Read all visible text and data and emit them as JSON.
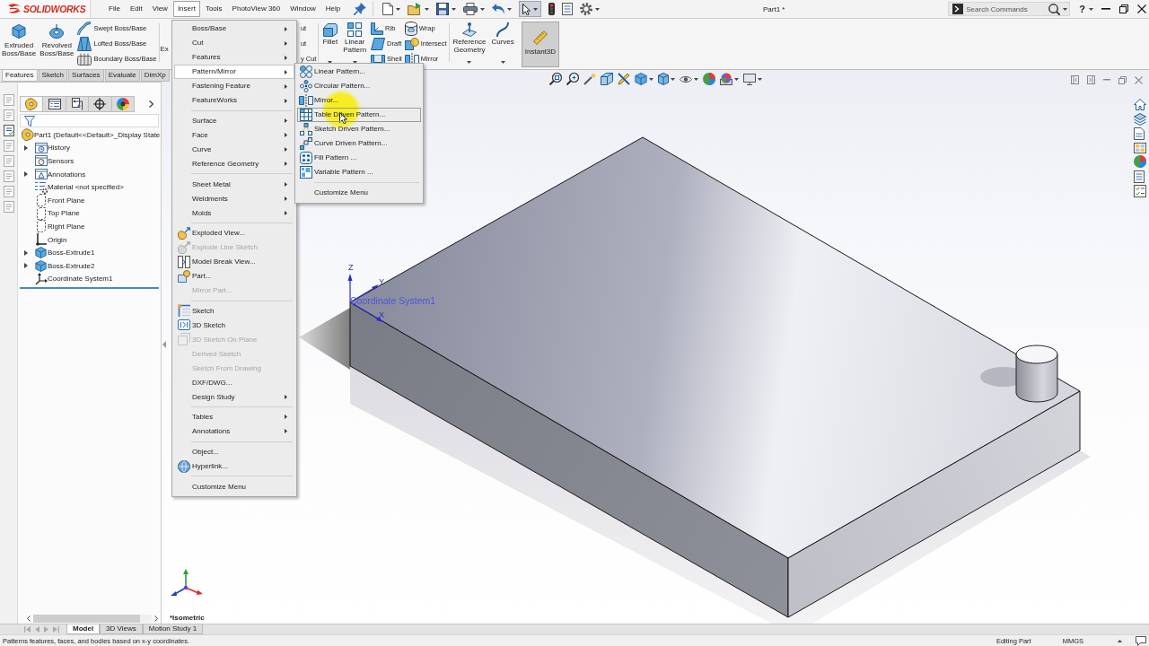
{
  "title_bar": {
    "logo": "SOLIDWORKS",
    "menus": [
      {
        "label": "File",
        "selected": false
      },
      {
        "label": "Edit",
        "selected": false
      },
      {
        "label": "View",
        "selected": false
      },
      {
        "label": "Insert",
        "selected": true
      },
      {
        "label": "Tools",
        "selected": false
      },
      {
        "label": "PhotoView 360",
        "selected": false
      },
      {
        "label": "Window",
        "selected": false
      },
      {
        "label": "Help",
        "selected": false
      }
    ],
    "document_title": "Part1 *",
    "search": {
      "placeholder": "Search Commands"
    },
    "help": "?"
  },
  "command_manager": {
    "groups": [
      [
        {
          "kind": "large",
          "label": "Extruded Boss/Base"
        },
        {
          "kind": "large",
          "label": "Revolved Boss/Base"
        },
        {
          "kind": "stack",
          "items": [
            "Swept Boss/Base",
            "Lofted Boss/Base",
            "Boundary Boss/Base"
          ]
        }
      ],
      [
        {
          "kind": "clipped",
          "label": "Ex"
        },
        {
          "kind": "clippedstack",
          "items": [
            "ut",
            "ut",
            "y Cut"
          ]
        }
      ],
      [
        {
          "kind": "split",
          "label": "Fillet"
        },
        {
          "kind": "split",
          "label": "Linear Pattern"
        },
        {
          "kind": "stack",
          "items": [
            "Rib",
            "Draft",
            "Shell"
          ]
        },
        {
          "kind": "stack",
          "items": [
            "Wrap",
            "Intersect",
            "Mirror"
          ]
        }
      ],
      [
        {
          "kind": "split",
          "label": "Reference Geometry"
        },
        {
          "kind": "split",
          "label": "Curves"
        },
        {
          "kind": "large",
          "label": "Instant3D",
          "on": true
        }
      ]
    ],
    "tabs": [
      {
        "label": "Features",
        "selected": true
      },
      {
        "label": "Sketch",
        "selected": false
      },
      {
        "label": "Surfaces",
        "selected": false
      },
      {
        "label": "Evaluate",
        "selected": false
      },
      {
        "label": "DimXp",
        "selected": false
      }
    ]
  },
  "side_toolbar": [
    {
      "disabled": true
    },
    {
      "disabled": true
    },
    {
      "disabled": false
    },
    {
      "disabled": true
    },
    {
      "disabled": true
    },
    {
      "disabled": true
    },
    {
      "disabled": true
    },
    {
      "disabled": true
    }
  ],
  "feature_manager": {
    "tabs": [
      {
        "selected": true
      },
      {
        "selected": false
      },
      {
        "selected": false
      },
      {
        "selected": false
      },
      {
        "selected": false
      }
    ],
    "tree": {
      "label": "Part1 (Default<<Default>_Display State",
      "kind": "part",
      "children": [
        {
          "label": "History",
          "kind": "history",
          "expandable": true
        },
        {
          "label": "Sensors",
          "kind": "sensors",
          "expandable": false
        },
        {
          "label": "Annotations",
          "kind": "annotations",
          "expandable": true
        },
        {
          "label": "Material <not specified>",
          "kind": "material",
          "expandable": false
        },
        {
          "label": "Front Plane",
          "kind": "plane",
          "expandable": false
        },
        {
          "label": "Top Plane",
          "kind": "plane",
          "expandable": false
        },
        {
          "label": "Right Plane",
          "kind": "plane",
          "expandable": false
        },
        {
          "label": "Origin",
          "kind": "origin",
          "expandable": false
        },
        {
          "label": "Boss-Extrude1",
          "kind": "feature",
          "expandable": true
        },
        {
          "label": "Boss-Extrude2",
          "kind": "feature",
          "expandable": true
        },
        {
          "label": "Coordinate System1",
          "kind": "coordinates",
          "expandable": false
        }
      ]
    }
  },
  "insert_menu": {
    "groups": [
      [
        {
          "label": "Boss/Base",
          "kind": "submenu",
          "selected": false,
          "disabled": false
        },
        {
          "label": "Cut",
          "kind": "submenu",
          "selected": false,
          "disabled": false
        },
        {
          "label": "Features",
          "kind": "submenu",
          "selected": false,
          "disabled": false
        },
        {
          "label": "Pattern/Mirror",
          "kind": "submenu",
          "selected": true,
          "disabled": false
        },
        {
          "label": "Fastening Feature",
          "kind": "submenu",
          "selected": false,
          "disabled": false
        },
        {
          "label": "FeatureWorks",
          "kind": "submenu",
          "selected": false,
          "disabled": false
        }
      ],
      [
        {
          "label": "Surface",
          "kind": "submenu",
          "selected": false,
          "disabled": false
        },
        {
          "label": "Face",
          "kind": "submenu",
          "selected": false,
          "disabled": false
        },
        {
          "label": "Curve",
          "kind": "submenu",
          "selected": false,
          "disabled": false
        },
        {
          "label": "Reference Geometry",
          "kind": "submenu",
          "selected": false,
          "disabled": false
        }
      ],
      [
        {
          "label": "Sheet Metal",
          "kind": "submenu",
          "selected": false,
          "disabled": false
        },
        {
          "label": "Weldments",
          "kind": "submenu",
          "selected": false,
          "disabled": false
        },
        {
          "label": "Molds",
          "kind": "submenu",
          "selected": false,
          "disabled": false
        }
      ],
      [
        {
          "label": "Exploded View...",
          "kind": "exploded",
          "selected": false,
          "disabled": false
        },
        {
          "label": "Explode Line Sketch",
          "kind": "explodeline",
          "selected": false,
          "disabled": true
        },
        {
          "label": "Model Break View...",
          "kind": "breakview",
          "selected": false,
          "disabled": false
        },
        {
          "label": "Part...",
          "kind": "part",
          "selected": false,
          "disabled": false
        },
        {
          "label": "Mirror Part...",
          "kind": "command",
          "selected": false,
          "disabled": true
        }
      ],
      [
        {
          "label": "Sketch",
          "kind": "sketch",
          "selected": false,
          "disabled": false
        },
        {
          "label": "3D Sketch",
          "kind": "sketch3d",
          "selected": false,
          "disabled": false
        },
        {
          "label": "3D Sketch On Plane",
          "kind": "planesketch",
          "selected": false,
          "disabled": true
        },
        {
          "label": "Derived Sketch",
          "kind": "command",
          "selected": false,
          "disabled": true
        },
        {
          "label": "Sketch From Drawing",
          "kind": "command",
          "selected": false,
          "disabled": true
        },
        {
          "label": "DXF/DWG...",
          "kind": "command",
          "selected": false,
          "disabled": false
        },
        {
          "label": "Design Study",
          "kind": "submenu",
          "selected": false,
          "disabled": false
        }
      ],
      [
        {
          "label": "Tables",
          "kind": "submenu",
          "selected": false,
          "disabled": false
        },
        {
          "label": "Annotations",
          "kind": "submenu",
          "selected": false,
          "disabled": false
        }
      ],
      [
        {
          "label": "Object...",
          "kind": "command",
          "selected": false,
          "disabled": false
        },
        {
          "label": "Hyperlink...",
          "kind": "hyperlink",
          "selected": false,
          "disabled": false
        }
      ],
      [
        {
          "label": "Customize Menu",
          "kind": "command",
          "selected": false,
          "disabled": false
        }
      ]
    ]
  },
  "pattern_menu": {
    "groups": [
      [
        {
          "label": "Linear Pattern...",
          "kind": "linear",
          "selected": false
        },
        {
          "label": "Circular Pattern...",
          "kind": "circular",
          "selected": false
        },
        {
          "label": "Mirror...",
          "kind": "mirror",
          "selected": false
        },
        {
          "label": "Table Driven Pattern...",
          "kind": "table",
          "selected": true
        },
        {
          "label": "Sketch Driven Pattern...",
          "kind": "sketchdriven",
          "selected": false
        },
        {
          "label": "Curve Driven Pattern...",
          "kind": "curvedriven",
          "selected": false
        },
        {
          "label": "Fill Pattern ...",
          "kind": "fill",
          "selected": false
        },
        {
          "label": "Variable Pattern ...",
          "kind": "variable",
          "selected": false
        }
      ],
      [
        {
          "label": "Customize Menu",
          "kind": "command",
          "selected": false
        }
      ]
    ]
  },
  "viewport": {
    "axes": [
      {
        "kind": "z",
        "label": "Z"
      },
      {
        "kind": "y",
        "label": "Y"
      },
      {
        "kind": "x",
        "label": "X"
      }
    ],
    "coordinate_system_label": "Coordinate System1",
    "view_name": "*Isometric"
  },
  "bottom_tabs": [
    {
      "label": "Model",
      "selected": true
    },
    {
      "label": "3D Views",
      "selected": false
    },
    {
      "label": "Motion Study 1",
      "selected": false
    }
  ],
  "status_bar": {
    "message": "Patterns features, faces, and bodies based on x-y coordinates.",
    "mode": "Editing Part",
    "units": "MMGS"
  }
}
